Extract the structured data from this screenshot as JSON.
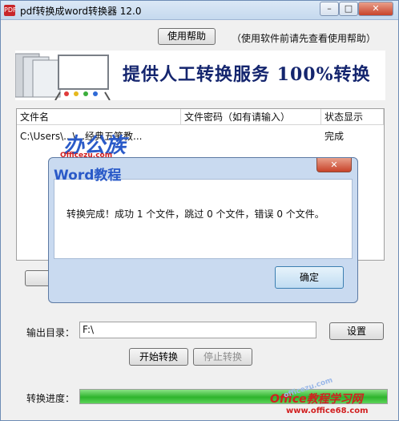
{
  "window": {
    "title": "pdf转换成word转换器 12.0",
    "close_label": "✕",
    "min_label": "–",
    "max_label": "□"
  },
  "help": {
    "button_label": "使用帮助",
    "note": "（使用软件前请先查看使用帮助）"
  },
  "banner": {
    "text": "提供人工转换服务 100%转换"
  },
  "file_list": {
    "columns": [
      "文件名",
      "文件密码（如有请输入）",
      "状态显示"
    ],
    "rows": [
      {
        "name": "C:\\Users\\...\\...经典五笔教...",
        "password": "",
        "status": "完成"
      }
    ]
  },
  "output": {
    "label": "输出目录：",
    "value": "F:\\",
    "set_button": "设置"
  },
  "actions": {
    "start": "开始转换",
    "stop": "停止转换"
  },
  "progress": {
    "label": "转换进度：",
    "fraction": 1.0
  },
  "dialog": {
    "message": "转换完成！成功 1 个文件，跳过 0 个文件，错误 0 个文件。",
    "ok_button": "确定",
    "close_label": "✕"
  },
  "watermarks": {
    "brand": "办公族",
    "brand_url": "Officezu.com",
    "brand_sub": "Word教程",
    "corner": "Office教程学习网",
    "corner_url": "www.office68.com",
    "corner_faint": "officezu.com"
  },
  "colors": {
    "progress": "#2db42c",
    "banner_text": "#14256e",
    "watermark_blue": "#2a5ac8",
    "watermark_red": "#d22020"
  }
}
